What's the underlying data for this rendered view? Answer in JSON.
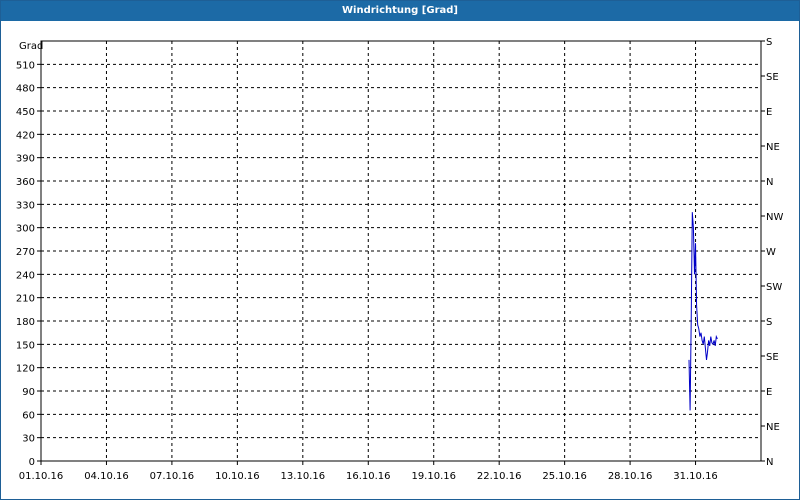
{
  "window": {
    "title": "Windrichtung [Grad]"
  },
  "chart_data": {
    "type": "line",
    "title": "Windrichtung [Grad]",
    "ylabel": "Grad",
    "xlabel": "",
    "ylim": [
      0,
      540
    ],
    "x_range": [
      "01.10.16",
      "01.11.16"
    ],
    "y_ticks": [
      0,
      30,
      60,
      90,
      120,
      150,
      180,
      210,
      240,
      270,
      300,
      330,
      360,
      390,
      420,
      450,
      480,
      510
    ],
    "x_ticks": [
      "01.10.16",
      "04.10.16",
      "07.10.16",
      "10.10.16",
      "13.10.16",
      "16.10.16",
      "19.10.16",
      "22.10.16",
      "25.10.16",
      "28.10.16",
      "31.10.16"
    ],
    "right_axis_labels": [
      "N",
      "NE",
      "E",
      "SE",
      "S",
      "SW",
      "W",
      "NW",
      "N",
      "NE",
      "E",
      "SE",
      "S"
    ],
    "grid": true,
    "line_color": "#0000c8",
    "series": [
      {
        "x": [
          30.7,
          30.75,
          30.8,
          30.85,
          30.9,
          30.95,
          31.0,
          31.05,
          31.1,
          31.15,
          31.2,
          31.25,
          31.3,
          31.35,
          31.4,
          31.45,
          31.5,
          31.55,
          31.6,
          31.65,
          31.7,
          31.75,
          31.8,
          31.85,
          31.9,
          31.95,
          32.0
        ],
        "y": [
          130,
          65,
          180,
          320,
          300,
          240,
          280,
          200,
          175,
          170,
          160,
          165,
          155,
          150,
          160,
          145,
          130,
          140,
          155,
          148,
          160,
          152,
          150,
          155,
          148,
          160,
          157
        ]
      }
    ]
  }
}
